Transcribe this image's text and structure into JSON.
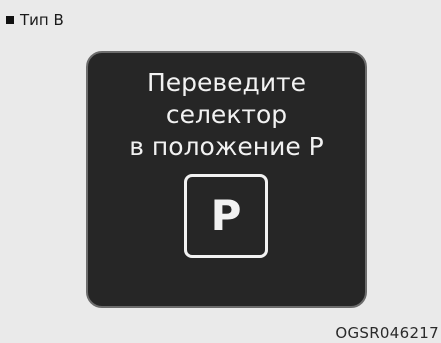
{
  "type_label": "Тип B",
  "panel": {
    "message_lines": [
      "Переведите",
      "селектор",
      "в положение P"
    ],
    "gear_letter": "P"
  },
  "image_code": "OGSR046217"
}
